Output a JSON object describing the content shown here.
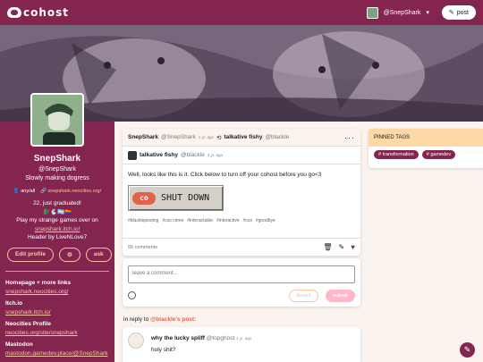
{
  "app": {
    "name": "cohost"
  },
  "topbar": {
    "user": "@SnepShark",
    "post_label": "post"
  },
  "profile": {
    "display_name": "SnepShark",
    "handle": "@SnepShark",
    "tagline": "Slowly making dogress",
    "pronouns": "any/all",
    "website": "snepshark.neocities.org/",
    "bio": [
      {
        "text": "22, just graduated!",
        "link": false
      },
      {
        "text": "🐉🐇🏳️‍⚧️🏳️‍🌈",
        "link": false
      },
      {
        "text": "Play my strange games over on",
        "link": false
      },
      {
        "text": "snepshark.itch.io!",
        "link": true
      },
      {
        "text": "Header by LiveNLove7",
        "link": false
      }
    ],
    "edit_label": "Edit profile",
    "ask_label": "ask",
    "links": [
      {
        "heading": "Homepage + more links",
        "url": "snepshark.neocities.org/"
      },
      {
        "heading": "Itch.io",
        "url": "snepshark.itch.io/"
      },
      {
        "heading": "Neocities Profile",
        "url": "neocities.org/site/snepshark"
      },
      {
        "heading": "Mastodon",
        "url": "mastodon.gamedev.place/@SnepShark"
      }
    ]
  },
  "post": {
    "author": "SnepShark",
    "handle": "@SnepShark",
    "time": "1 yr. ago",
    "shared_name": "talkative fishy",
    "shared_handle": "@blackle",
    "share_time": "3 yr. ago",
    "body": "Well, looks like this is it. Click below to turn off your cohost before you go<3",
    "button_text": "SHUT DOWN",
    "button_logo": "co",
    "tags": [
      "#blacklepesting",
      "#css crime",
      "#interactable",
      "#interactive",
      "#css",
      "#goodbye"
    ],
    "comments": "55 comments"
  },
  "compose": {
    "placeholder": "leave a comment...",
    "discard": "discard",
    "submit": "submit"
  },
  "inreply": {
    "prefix": "in reply to",
    "who": "@blackle's post:"
  },
  "reply": {
    "name": "why the lucky spliff",
    "handle": "@topghost",
    "time": "1 yr. ago",
    "text": "holy shit?"
  },
  "pinned": {
    "title": "PINNED TAGS",
    "tags": [
      "# transformation",
      "# gamedev"
    ]
  },
  "colors": {
    "brand": "#83254f",
    "accent": "#ffc4a5",
    "bg": "#fbf3ee"
  }
}
